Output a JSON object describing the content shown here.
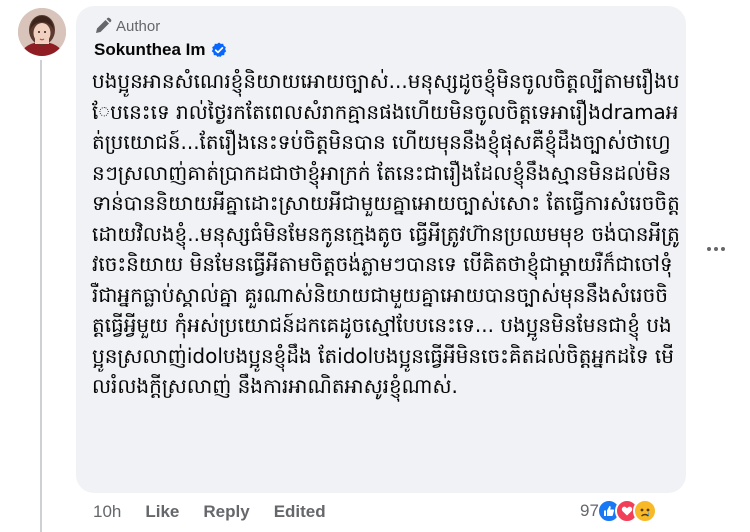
{
  "comment": {
    "author_badge": "Author",
    "author_name": "Sokunthea Im",
    "text": "បងប្អូនអានសំណេរខ្ញុំនិយាយអោយច្បាស់...មនុស្សដូចខ្ញុំមិនចូលចិត្តល្បីតាមរឿងបែបនេះទេ រាល់ថ្ងៃរកតែពេលសំរាកគ្មានផងហើយមិនចូលចិត្តទេអារឿងdramaអត់ប្រយោជន៍...តែរឿងនេះទប់ចិត្តមិនបាន ហើយមុននឹងខ្ញុំផុសគឺខ្ញុំដឹងច្បាស់ថាហ្វេនៗស្រលាញ់គាត់ប្រាកដជាថាខ្ញុំអាក្រក់ តែនេះជារឿងដែលខ្ញុំនឹងស្មានមិនដល់មិនទាន់បាននិយាយអីគ្នាដោះស្រាយអីជាមួយគ្នាអោយច្បាស់សោះ តែធ្វើការសំរេចចិត្តដោយវិលងខ្ញុំ..មនុស្សធំមិនមែនកូនក្មេងតូច ធ្វើអីត្រូវហ៊ានប្រឈមមុខ ចង់បានអីត្រូវចេះនិយាយ មិនមែនធ្វើអីតាមចិត្តចង់ភ្លាមៗបានទេ បើគិតថាខ្ញុំជាម្តាយរឺក៏ជាចៅទុំ រឺជាអ្នកធ្លាប់ស្គាល់គ្នា គួរណាស់និយាយជាមួយគ្នាអោយបានច្បាស់មុននឹងសំរេចចិត្តធ្វើអ្វីមួយ កុំអស់ប្រយោជន៍ដកគេដូចស្មៅបែបនេះទេ... បងប្អូនមិនមែនជាខ្ញុំ បងប្អូនស្រលាញ់idolបងប្អូនខ្ញុំដឹង តែidolបងប្អូនធ្វើអីមិនចេះគិតដល់ចិត្តអ្នកដទៃ មើលរំលងក្តីស្រលាញ់ នឹងការអាណិតអាសូរខ្ញុំណាស់.",
    "time": "10h",
    "like_label": "Like",
    "reply_label": "Reply",
    "edited_label": "Edited",
    "reaction_count": "97"
  },
  "icons": {
    "badge": "pencil-icon",
    "verified": "verified-badge-icon",
    "more": "more-options-icon",
    "reactions": [
      "like-reaction-icon",
      "love-reaction-icon",
      "sad-reaction-icon"
    ]
  },
  "colors": {
    "bubble": "#f0f2f5",
    "verified": "#0866ff",
    "like": "#1877f2",
    "love": "#f33e58",
    "sad": "#f7b928",
    "secondary_text": "#65676b"
  }
}
